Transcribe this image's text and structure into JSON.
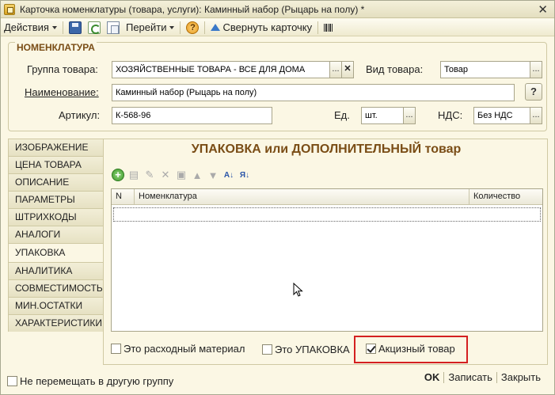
{
  "window": {
    "title": "Карточка номенклатуры (товара, услуги): Каминный набор (Рыцарь на полу) *",
    "close": "✕"
  },
  "toolbar": {
    "actions": "Действия",
    "goto": "Перейти",
    "help": "?",
    "collapse": "Свернуть карточку"
  },
  "nomenclature": {
    "section_title": "НОМЕНКЛАТУРА",
    "group_label": "Группа товара:",
    "group_value": "ХОЗЯЙСТВЕННЫЕ ТОВАРА - ВСЕ ДЛЯ ДОМА",
    "kind_label": "Вид товара:",
    "kind_value": "Товар",
    "name_label": "Наименование:",
    "name_value": "Каминный набор (Рыцарь на полу)",
    "help": "?",
    "article_label": "Артикул:",
    "article_value": "К-568-96",
    "unit_label": "Ед.",
    "unit_value": "шт.",
    "vat_label": "НДС:",
    "vat_value": "Без НДС",
    "ellipsis": "...",
    "clear": "✕"
  },
  "tabs": [
    {
      "label": "ИЗОБРАЖЕНИЕ"
    },
    {
      "label": "ЦЕНА ТОВАРА"
    },
    {
      "label": "ОПИСАНИЕ"
    },
    {
      "label": "ПАРАМЕТРЫ"
    },
    {
      "label": "ШТРИХКОДЫ"
    },
    {
      "label": "АНАЛОГИ"
    },
    {
      "label": "УПАКОВКА"
    },
    {
      "label": "АНАЛИТИКА"
    },
    {
      "label": "СОВМЕСТИМОСТЬ"
    },
    {
      "label": "МИН.ОСТАТКИ"
    },
    {
      "label": "ХАРАКТЕРИСТИКИ"
    }
  ],
  "panel": {
    "title": "УПАКОВКА или ДОПОЛНИТЕЛЬНЫЙ товар",
    "columns": {
      "n": "N",
      "name": "Номенклатура",
      "qty": "Количество"
    },
    "add_icon": "+",
    "sort_asc": "А↓",
    "sort_desc": "Я↓"
  },
  "checks": {
    "consumable": {
      "label": "Это расходный материал",
      "checked": false
    },
    "package": {
      "label": "Это УПАКОВКА",
      "checked": false
    },
    "excise": {
      "label": "Акцизный товар",
      "checked": true
    }
  },
  "footer": {
    "dont_move": {
      "label": "Не перемещать в другую группу",
      "checked": false
    },
    "ok": "OK",
    "save": "Записать",
    "close": "Закрыть"
  },
  "colors": {
    "accent": "#7a4d16",
    "highlight": "#d42020",
    "background": "#fbf7e4"
  }
}
